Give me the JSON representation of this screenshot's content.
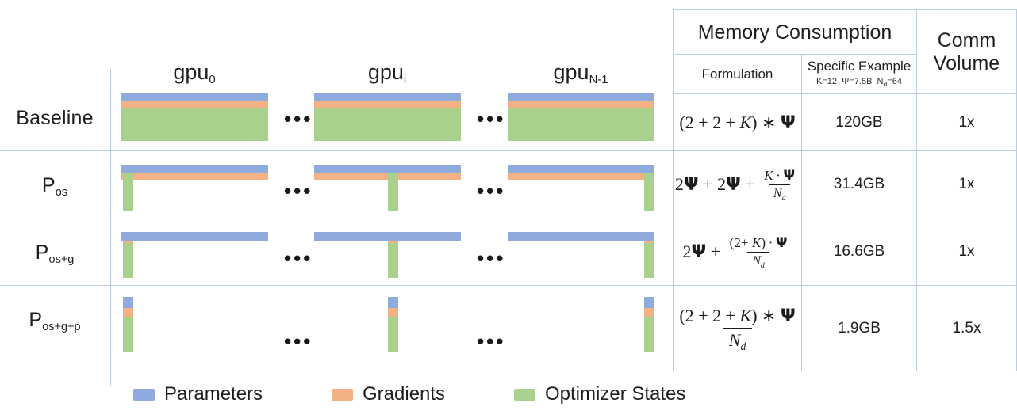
{
  "figure": {
    "colors": {
      "parameters": "#8faadc",
      "gradients": "#f4b183",
      "optimizer_states": "#a9d18e",
      "grid_line": "#b9cde4"
    },
    "gpu_headers": [
      {
        "base": "gpu",
        "sub": "0"
      },
      {
        "base": "gpu",
        "sub": "i"
      },
      {
        "base": "gpu",
        "sub": "N-1"
      }
    ],
    "ellipsis": "•••",
    "rows": [
      {
        "label_base": "Baseline",
        "label_sub": "",
        "memory": "120GB",
        "comm": "1x"
      },
      {
        "label_base": "P",
        "label_sub": "os",
        "memory": "31.4GB",
        "comm": "1x"
      },
      {
        "label_base": "P",
        "label_sub": "os+g",
        "memory": "16.6GB",
        "comm": "1x"
      },
      {
        "label_base": "P",
        "label_sub": "os+g+p",
        "memory": "1.9GB",
        "comm": "1.5x"
      }
    ],
    "table": {
      "memory_consumption_header": "Memory Consumption",
      "formulation_header": "Formulation",
      "specific_example_header": "Specific Example",
      "specific_example_params": {
        "k": "K=12",
        "psi": "Ψ=7.5B",
        "nd": "N",
        "nd_sub": "d",
        "nd_val": "=64"
      },
      "comm_volume_header_line1": "Comm",
      "comm_volume_header_line2": "Volume"
    },
    "formulas": {
      "baseline": "(2 + 2 + K) ∗ Ψ",
      "p_os": "2Ψ + 2Ψ + (K ∗ Ψ) / N_d",
      "p_os_g": "2Ψ + ((2 + K) ∗ Ψ) / N_d",
      "p_os_g_p": "((2 + 2 + K) ∗ Ψ) / N_d"
    },
    "legend": [
      {
        "label": "Parameters",
        "color": "#8faadc"
      },
      {
        "label": "Gradients",
        "color": "#f4b183"
      },
      {
        "label": "Optimizer States",
        "color": "#a9d18e"
      }
    ]
  }
}
